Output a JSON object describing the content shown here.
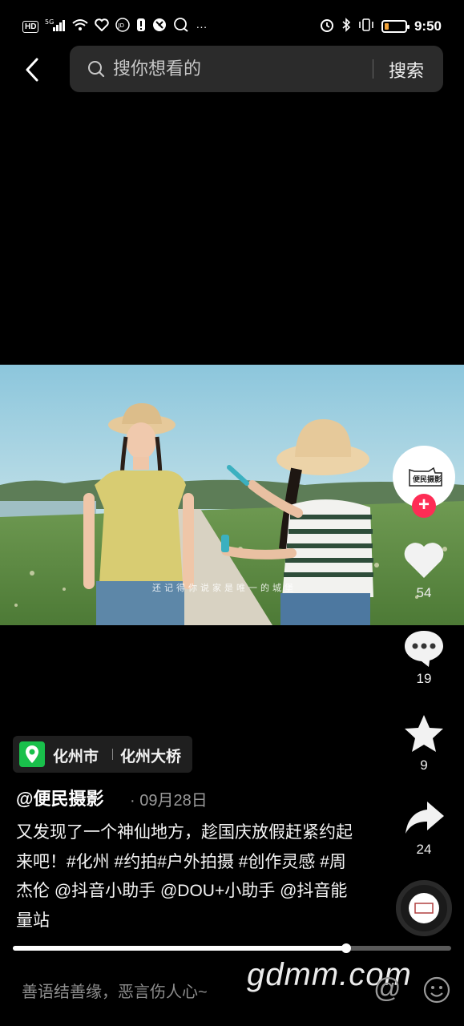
{
  "status_bar": {
    "network": "HD",
    "signal": "5G",
    "time": "9:50",
    "battery_level": 0.2,
    "battery_color": "#f2a33a"
  },
  "header": {
    "back_icon": "chevron-left-icon",
    "search_placeholder": "搜你想看的",
    "search_button": "搜索"
  },
  "video": {
    "overlay_text": "还记得你说家是唯一的城堡"
  },
  "right_rail": {
    "avatar_label": "便民摄影",
    "follow_symbol": "+",
    "like_count": "54",
    "comment_count": "19",
    "favorite_count": "9",
    "share_count": "24"
  },
  "location": {
    "city": "化州市",
    "place": "化州大桥"
  },
  "post": {
    "author": "@便民摄影",
    "date": "· 09月28日",
    "caption": "又发现了一个神仙地方，趁国庆放假赶紧约起来吧！#化州 #约拍#户外拍摄 #创作灵感 #周杰伦 @抖音小助手 @DOU+小助手 @抖音能量站"
  },
  "progress": {
    "value": 0.76
  },
  "comment_bar": {
    "placeholder": "善语结善缘，恶言伤人心~",
    "at_symbol": "@",
    "watermark": "gdmm.com"
  },
  "colors": {
    "follow": "#fe2c55",
    "location_pin": "#19c04b"
  }
}
